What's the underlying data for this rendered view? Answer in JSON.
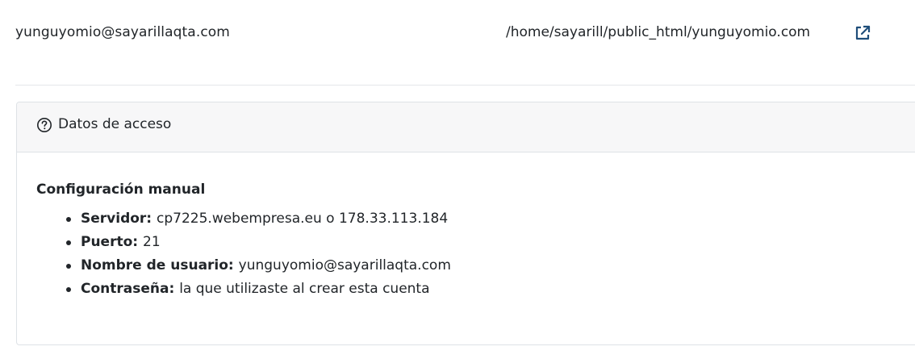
{
  "account": {
    "user": "yunguyomio@sayarillaqta.com",
    "path": "/home/sayarill/public_html/yunguyomio.com",
    "open_link_icon": "external-link-icon"
  },
  "access_panel": {
    "icon": "question-circle-icon",
    "title": "Datos de acceso",
    "section_title": "Configuración manual",
    "items": [
      {
        "label": "Servidor:",
        "value": "cp7225.webempresa.eu o 178.33.113.184"
      },
      {
        "label": "Puerto:",
        "value": "21"
      },
      {
        "label": "Nombre de usuario:",
        "value": "yunguyomio@sayarillaqta.com"
      },
      {
        "label": "Contraseña:",
        "value": "la que utilizaste al crear esta cuenta"
      }
    ]
  },
  "colors": {
    "text": "#212529",
    "header_bg": "#f7f7f8",
    "border": "#dee2e6",
    "icon": "#1f4e7a"
  }
}
